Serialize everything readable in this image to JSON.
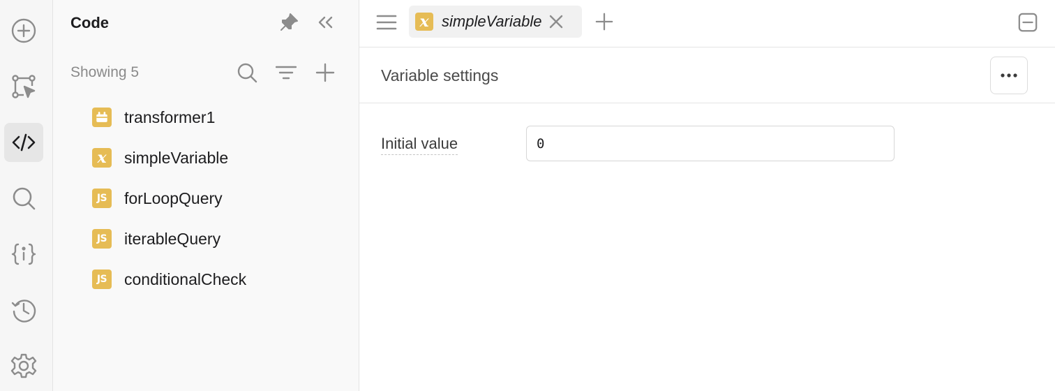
{
  "rail": {
    "items": [
      {
        "name": "add-circle-icon"
      },
      {
        "name": "select-frame-icon"
      },
      {
        "name": "code-icon",
        "active": true
      },
      {
        "name": "search-icon"
      },
      {
        "name": "variables-braces-icon"
      },
      {
        "name": "history-icon"
      },
      {
        "name": "gear-icon"
      }
    ]
  },
  "panel": {
    "title": "Code",
    "showing": "Showing 5",
    "items": [
      {
        "label": "transformer1",
        "type": "transformer"
      },
      {
        "label": "simpleVariable",
        "type": "variable"
      },
      {
        "label": "forLoopQuery",
        "type": "js"
      },
      {
        "label": "iterableQuery",
        "type": "js"
      },
      {
        "label": "conditionalCheck",
        "type": "js"
      }
    ],
    "js_badge": "JS",
    "var_badge": "x"
  },
  "tabs": {
    "active": {
      "label": "simpleVariable",
      "badge": "x"
    }
  },
  "settings": {
    "title": "Variable settings",
    "initial_value_label": "Initial value",
    "initial_value": "0"
  },
  "colors": {
    "badge": "#e6bc55",
    "rail_bg": "#f6f6f6",
    "panel_bg": "#f9f9f9",
    "icon_gray": "#8c8c8c"
  }
}
